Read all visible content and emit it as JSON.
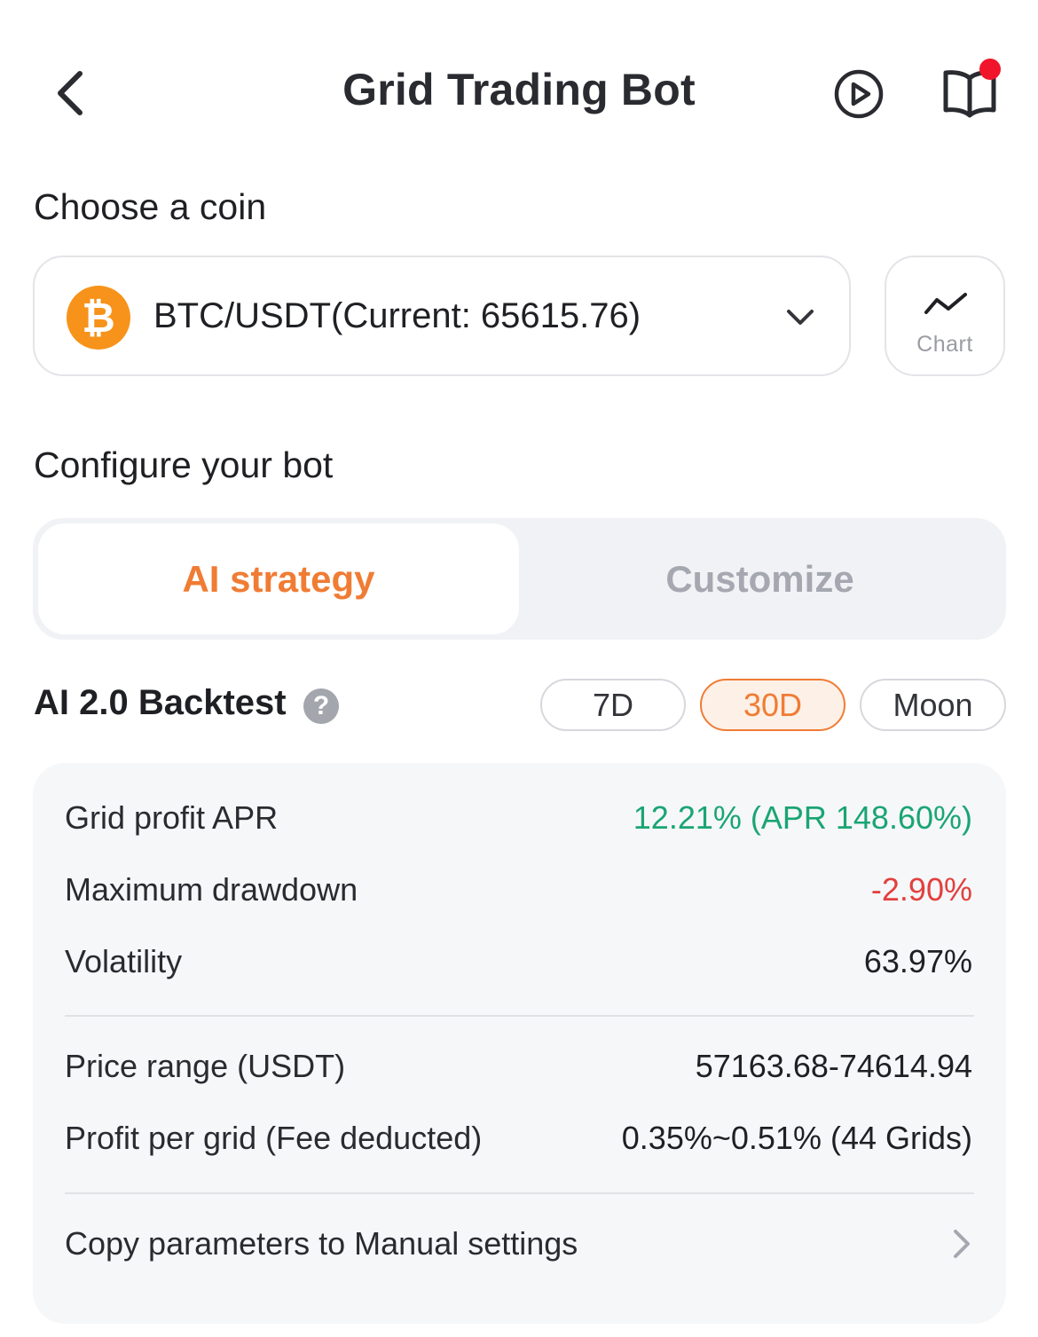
{
  "header": {
    "title": "Grid Trading Bot",
    "back_icon": "chevron-left-icon",
    "play_icon": "play-circle-icon",
    "guide_icon": "book-open-icon",
    "notification_dot_color": "#f0152a"
  },
  "coin_section": {
    "label": "Choose a coin",
    "coin_symbol": "₿",
    "pair_text": "BTC/USDT(Current: 65615.76)",
    "coin_color": "#f7931a",
    "chart_label": "Chart"
  },
  "configure_section": {
    "label": "Configure your bot",
    "tabs": [
      {
        "label": "AI strategy",
        "active": true
      },
      {
        "label": "Customize",
        "active": false
      }
    ],
    "accent_color": "#f07c34"
  },
  "backtest": {
    "title": "AI 2.0 Backtest",
    "help_symbol": "?",
    "periods": [
      {
        "label": "7D",
        "active": false
      },
      {
        "label": "30D",
        "active": true
      },
      {
        "label": "Moon",
        "active": false
      }
    ]
  },
  "stats": {
    "grid_profit_apr": {
      "label": "Grid profit APR",
      "value": "12.21% (APR 148.60%)",
      "color": "#1aa573"
    },
    "max_drawdown": {
      "label": "Maximum drawdown",
      "value": "-2.90%",
      "color": "#e2403e"
    },
    "volatility": {
      "label": "Volatility",
      "value": "63.97%"
    },
    "price_range": {
      "label": "Price range (USDT)",
      "value": "57163.68-74614.94"
    },
    "profit_per_grid": {
      "label": "Profit per grid (Fee deducted)",
      "value": "0.35%~0.51% (44 Grids)"
    },
    "copy_params": {
      "label": "Copy parameters to Manual settings"
    }
  }
}
